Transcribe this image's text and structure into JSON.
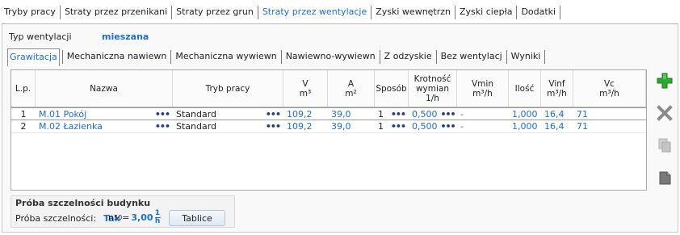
{
  "top_tabs": [
    {
      "label": "Tryby pracy"
    },
    {
      "label": "Straty przez przenikani"
    },
    {
      "label": "Straty przez grun"
    },
    {
      "label": "Straty przez wentylacje"
    },
    {
      "label": "Zyski wewnętrzn"
    },
    {
      "label": "Zyski ciepła"
    },
    {
      "label": "Dodatki"
    }
  ],
  "active_top_tab": "Straty przez wentylacje",
  "ventilation_type": {
    "label": "Typ wentylacji",
    "value": "mieszana"
  },
  "sub_tabs": [
    {
      "label": "Grawitacja"
    },
    {
      "label": "Mechaniczna nawiewn"
    },
    {
      "label": "Mechaniczna wywiewn"
    },
    {
      "label": "Nawiewno-wywiewn"
    },
    {
      "label": "Z odzyskie"
    },
    {
      "label": "Bez wentylacj"
    },
    {
      "label": "Wyniki"
    }
  ],
  "active_sub_tab": "Grawitacja",
  "table": {
    "headers": {
      "lp": "L.p.",
      "name": "Nazwa",
      "mode": "Tryb pracy",
      "v": "V",
      "v_unit": "m³",
      "a": "A",
      "a_unit": "m²",
      "method": "Sposób",
      "rate_l1": "Krotność",
      "rate_l2": "wymian",
      "rate_l3": "1/h",
      "vmin": "Vmin",
      "vmin_unit": "m³/h",
      "qty": "Ilość",
      "vinf": "Vinf",
      "vinf_unit": "m³/h",
      "vc": "Vc",
      "vc_unit": "m³/h"
    },
    "rows": [
      {
        "lp": "1",
        "name": "M.01 Pokój",
        "mode": "Standard",
        "v": "109,2",
        "a": "39,0",
        "method": "1",
        "rate": "0,500",
        "vmin": "-",
        "qty": "1,000",
        "vinf": "16,4",
        "vc": "71"
      },
      {
        "lp": "2",
        "name": "M.02 Łazienka",
        "mode": "Standard",
        "v": "109,2",
        "a": "39,0",
        "method": "1",
        "rate": "0,500",
        "vmin": "-",
        "qty": "1,000",
        "vinf": "16,4",
        "vc": "71"
      }
    ],
    "ellipsis": "•••"
  },
  "side_buttons": [
    {
      "icon": "add-icon",
      "color": "#2fa82f"
    },
    {
      "icon": "delete-icon",
      "color": "#8a8a8a"
    },
    {
      "icon": "copy-icon",
      "color": "#b0b0b0"
    },
    {
      "icon": "paste-icon",
      "color": "#6a6a6a"
    }
  ],
  "airtightness": {
    "title": "Próba szczelności budynku",
    "label": "Próba szczelności:",
    "value": "Tak",
    "n50_symbol": "n",
    "n50_sub": "50",
    "n50_eq": "=",
    "n50_value": "3,00",
    "n50_unit_num": "1",
    "n50_unit_den": "h",
    "button": "Tablice"
  },
  "colors": {
    "accent": "#1b6ed8",
    "add_green": "#2fa82f"
  }
}
